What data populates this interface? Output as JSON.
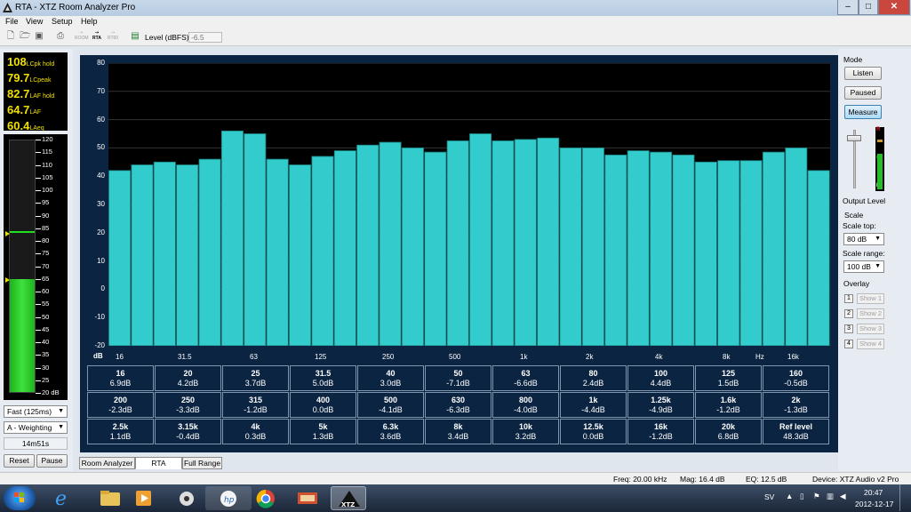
{
  "window": {
    "title": "RTA - XTZ Room Analyzer Pro"
  },
  "menu": [
    "File",
    "View",
    "Setup",
    "Help"
  ],
  "toolbar": {
    "level_label": "Level (dBFS)",
    "level_value": "-6.5",
    "mode_icons": [
      "ROOM",
      "RTA",
      "RT60"
    ]
  },
  "levels": [
    {
      "value": "108",
      "unit": "LCpk hold"
    },
    {
      "value": "79.7",
      "unit": "LCpeak"
    },
    {
      "value": "82.7",
      "unit": "LAF hold"
    },
    {
      "value": "64.7",
      "unit": "LAF"
    },
    {
      "value": "60.4",
      "unit": "LAeq"
    }
  ],
  "meter": {
    "ticks": [
      "120",
      "115",
      "110",
      "105",
      "100",
      "95",
      "90",
      "85",
      "80",
      "75",
      "70",
      "65",
      "60",
      "55",
      "50",
      "45",
      "40",
      "35",
      "30",
      "25",
      "20 dB"
    ],
    "level": 64.7,
    "hold": 82.7,
    "min": 20,
    "max": 120
  },
  "left_controls": {
    "speed": "Fast (125ms)",
    "weighting": "A - Weighting",
    "elapsed": "14m51s",
    "reset_label": "Reset",
    "pause_label": "Pause"
  },
  "mode": {
    "label": "Mode",
    "listen": "Listen",
    "paused": "Paused",
    "measure": "Measure",
    "output_level": "Output Level",
    "meter_labels": [
      "R",
      "G",
      "L"
    ]
  },
  "scale": {
    "label": "Scale",
    "top_label": "Scale top:",
    "top_value": "80 dB",
    "range_label": "Scale range:",
    "range_value": "100 dB"
  },
  "overlay": {
    "label": "Overlay",
    "items": [
      {
        "num": "1",
        "label": "Show 1"
      },
      {
        "num": "2",
        "label": "Show 2"
      },
      {
        "num": "3",
        "label": "Show 3"
      },
      {
        "num": "4",
        "label": "Show 4"
      }
    ]
  },
  "chart_data": {
    "type": "bar",
    "ylabel": "dB",
    "ylim": [
      -20,
      80
    ],
    "yticks": [
      "80",
      "70",
      "60",
      "50",
      "40",
      "30",
      "20",
      "10",
      "0",
      "-10",
      "-20"
    ],
    "xticks": [
      "16",
      "31.5",
      "63",
      "125",
      "250",
      "500",
      "1k",
      "2k",
      "4k",
      "8k",
      "Hz",
      "16k"
    ],
    "categories": [
      "16",
      "20",
      "25",
      "31.5",
      "40",
      "50",
      "63",
      "80",
      "100",
      "125",
      "160",
      "200",
      "250",
      "315",
      "400",
      "500",
      "630",
      "800",
      "1k",
      "1.25k",
      "1.6k",
      "2k",
      "2.5k",
      "3.15k",
      "4k",
      "5k",
      "6.3k",
      "8k",
      "10k",
      "12.5k",
      "16k",
      "20k"
    ],
    "values": [
      42,
      44,
      45,
      44,
      46,
      56,
      55,
      46,
      44,
      47,
      49,
      51,
      52,
      50,
      48.5,
      52.5,
      55,
      52.5,
      53,
      53.5,
      50,
      50,
      47.5,
      49,
      48.5,
      47.5,
      45,
      45.5,
      45.5,
      48.5,
      50,
      42
    ],
    "bar_color": "#33cccc",
    "background": "#000000",
    "grid": true
  },
  "table": [
    [
      {
        "f": "16",
        "v": "6.9dB"
      },
      {
        "f": "20",
        "v": "4.2dB"
      },
      {
        "f": "25",
        "v": "3.7dB"
      },
      {
        "f": "31.5",
        "v": "5.0dB"
      },
      {
        "f": "40",
        "v": "3.0dB"
      },
      {
        "f": "50",
        "v": "-7.1dB"
      },
      {
        "f": "63",
        "v": "-6.6dB"
      },
      {
        "f": "80",
        "v": "2.4dB"
      },
      {
        "f": "100",
        "v": "4.4dB"
      },
      {
        "f": "125",
        "v": "1.5dB"
      },
      {
        "f": "160",
        "v": "-0.5dB"
      }
    ],
    [
      {
        "f": "200",
        "v": "-2.3dB"
      },
      {
        "f": "250",
        "v": "-3.3dB"
      },
      {
        "f": "315",
        "v": "-1.2dB"
      },
      {
        "f": "400",
        "v": "0.0dB"
      },
      {
        "f": "500",
        "v": "-4.1dB"
      },
      {
        "f": "630",
        "v": "-6.3dB"
      },
      {
        "f": "800",
        "v": "-4.0dB"
      },
      {
        "f": "1k",
        "v": "-4.4dB"
      },
      {
        "f": "1.25k",
        "v": "-4.9dB"
      },
      {
        "f": "1.6k",
        "v": "-1.2dB"
      },
      {
        "f": "2k",
        "v": "-1.3dB"
      }
    ],
    [
      {
        "f": "2.5k",
        "v": "1.1dB"
      },
      {
        "f": "3.15k",
        "v": "-0.4dB"
      },
      {
        "f": "4k",
        "v": "0.3dB"
      },
      {
        "f": "5k",
        "v": "1.3dB"
      },
      {
        "f": "6.3k",
        "v": "3.6dB"
      },
      {
        "f": "8k",
        "v": "3.4dB"
      },
      {
        "f": "10k",
        "v": "3.2dB"
      },
      {
        "f": "12.5k",
        "v": "0.0dB"
      },
      {
        "f": "16k",
        "v": "-1.2dB"
      },
      {
        "f": "20k",
        "v": "6.8dB"
      },
      {
        "f": "Ref level",
        "v": "48.3dB"
      }
    ]
  ],
  "tabs": [
    "Room Analyzer",
    "RTA",
    "Full Range"
  ],
  "status": {
    "freq": "Freq: 20.00 kHz",
    "mag": "Mag: 16.4 dB",
    "eq": "EQ: 12.5 dB",
    "device": "Device: XTZ Audio v2 Pro"
  },
  "taskbar": {
    "lang": "SV",
    "time": "20:47",
    "date": "2012-12-17",
    "app_label": "XTZ"
  }
}
